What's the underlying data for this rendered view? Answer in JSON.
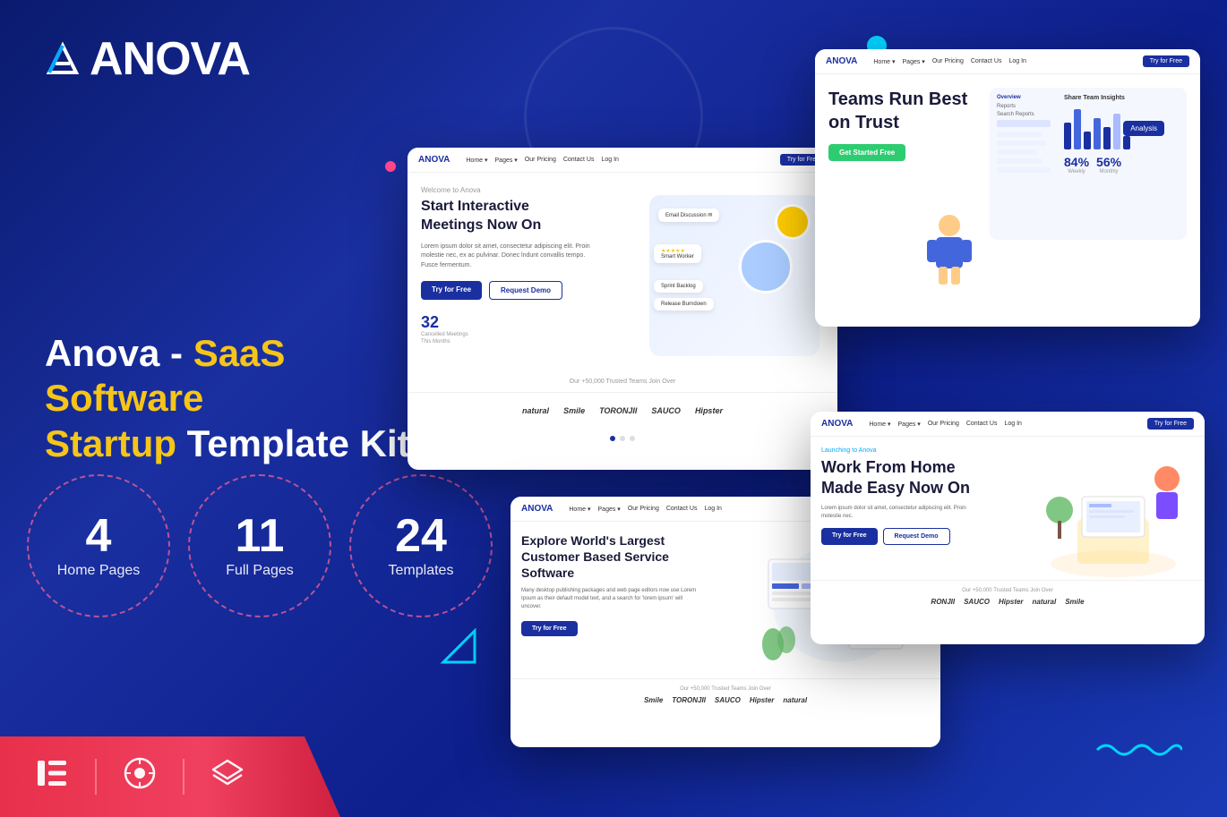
{
  "brand": {
    "name": "ANOVA",
    "logo_letter": "A"
  },
  "heading": {
    "line1": "Anova - ",
    "highlighted1": "SaaS Software",
    "line2_prefix": "",
    "highlighted2": "Startup",
    "line2_suffix": " Template Kit"
  },
  "stats": [
    {
      "number": "4",
      "label": "Home Pages"
    },
    {
      "number": "11",
      "label": "Full Pages"
    },
    {
      "number": "24",
      "label": "Templates"
    }
  ],
  "bottom_icons": [
    "elementor-icon",
    "wordpress-icon",
    "layers-icon"
  ],
  "cards": {
    "card1": {
      "badge": "Welcome to Anova",
      "hero": "Start Interactive Meetings Now On",
      "sub": "Lorem ipsum dolor sit amet, consectetur adipiscing elit. Proin molestie nec, ex ac pulvinar. Donec lndunt convallis tempo. Fusce fermentum.",
      "btn_primary": "Try for Free",
      "btn_secondary": "Request Demo",
      "stat_number": "32",
      "stat_label": "Cancelled Meetings\nThis Months",
      "brands": [
        "natural",
        "Smile",
        "TORONJII",
        "SAUCO",
        "Hipster"
      ],
      "brand_label": "Our +50,000 Trusted Teams Join Over"
    },
    "card2": {
      "nav_links": [
        "Home",
        "Pages",
        "Our Pricing",
        "Contact Us",
        "Log In"
      ],
      "btn": "Try for Free",
      "hero": "Teams Run Best on Trust",
      "cta_btn": "Get Started Free",
      "badge": "Analysis"
    },
    "card3": {
      "nav_links": [
        "Home",
        "Pages",
        "Our Pricing",
        "Contact Us",
        "Log In"
      ],
      "btn": "Try for Free",
      "hero": "Work From Home Made Easy Now On",
      "sub": "Lorem ipsum dolor sit amet, consectetur adipiscing elit. Proin molestie nec.",
      "btn_primary": "Try for Free",
      "btn_secondary": "Request Demo",
      "badge": "Launching to Anova",
      "brands": [
        "RONJII",
        "SAUCO",
        "Hipster",
        "natural",
        "Smile"
      ],
      "brand_label": "Our +50,000 Trusted Teams Join Over"
    },
    "card4": {
      "nav_links": [
        "Home",
        "Pages",
        "Our Pricing",
        "Contact Us",
        "Log In"
      ],
      "btn": "Try for Free",
      "hero": "Explore World's Largest Customer Based Service Software",
      "sub": "Many desktop publishing packages and web page editors now use Lorem Ipsum as their default model text, and a search for 'lorem ipsum' will uncover.",
      "btn_primary": "Try for Free",
      "brands": [
        "Smile",
        "TORONJII",
        "SAUCO",
        "Hipster",
        "natural"
      ],
      "brand_label": "Our +50,000 Trusted Teams Join Over"
    }
  },
  "colors": {
    "primary_blue": "#1a2fa0",
    "accent_yellow": "#f5c518",
    "accent_red": "#e8304a",
    "accent_cyan": "#00d4ff",
    "background_dark": "#0a1a6e"
  }
}
